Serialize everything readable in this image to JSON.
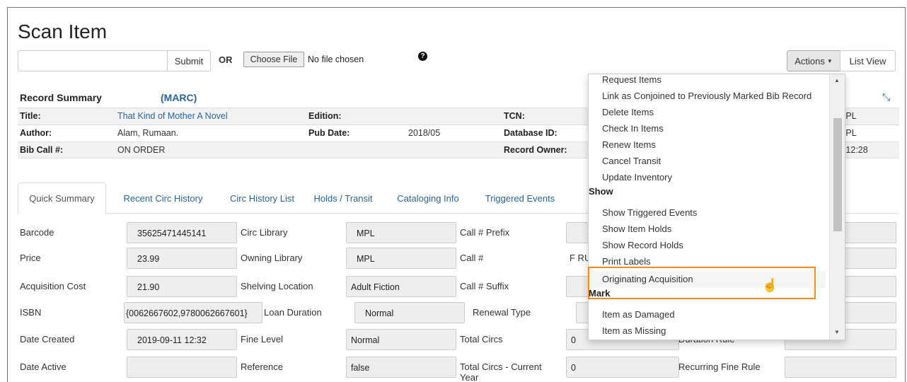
{
  "page": {
    "title": "Scan Item"
  },
  "scan": {
    "submit": "Submit",
    "or": "OR",
    "choose_file": "Choose File",
    "no_file": "No file chosen",
    "help_icon": "question-circle-icon"
  },
  "top_buttons": {
    "actions": "Actions",
    "list_view": "List View"
  },
  "record_summary": {
    "heading": "Record Summary",
    "marc": "(MARC)",
    "rows": [
      {
        "l1": "Title:",
        "v1": "That Kind of Mother A Novel",
        "l2": "Edition:",
        "v2": "",
        "l3": "TCN:",
        "v3": "MPL"
      },
      {
        "l1": "Author:",
        "v1": "Alam, Rumaan.",
        "l2": "Pub Date:",
        "v2": "2018/05",
        "l3": "Database ID:",
        "v3": "MPL"
      },
      {
        "l1": "Bib Call #:",
        "v1": "ON ORDER",
        "l2": "",
        "v2": "",
        "l3": "Record Owner:",
        "v3": "1 12:28"
      }
    ]
  },
  "tabs": [
    "Quick Summary",
    "Recent Circ History",
    "Circ History List",
    "Holds / Transit",
    "Cataloging Info",
    "Triggered Events"
  ],
  "fields": {
    "barcode": {
      "label": "Barcode",
      "value": "35625471445141"
    },
    "price": {
      "label": "Price",
      "value": "23.99"
    },
    "acq_cost": {
      "label": "Acquisition Cost",
      "value": "21.90"
    },
    "isbn": {
      "label": "ISBN",
      "value": "{0062667602,9780062667601}"
    },
    "date_created": {
      "label": "Date Created",
      "value": "2019-09-11 12:32"
    },
    "date_active": {
      "label": "Date Active",
      "value": ""
    },
    "circ_library": {
      "label": "Circ Library",
      "value": "MPL"
    },
    "owning_library": {
      "label": "Owning Library",
      "value": "MPL"
    },
    "shelving_location": {
      "label": "Shelving Location",
      "value": "Adult Fiction"
    },
    "loan_duration": {
      "label": "Loan Duration",
      "value": "Normal"
    },
    "fine_level": {
      "label": "Fine Level",
      "value": "Normal"
    },
    "reference": {
      "label": "Reference",
      "value": "false"
    },
    "call_prefix": {
      "label": "Call # Prefix",
      "value": ""
    },
    "call_num": {
      "label": "Call #",
      "value": "F RU"
    },
    "call_suffix": {
      "label": "Call # Suffix",
      "value": ""
    },
    "renewal_type": {
      "label": "Renewal Type",
      "value": ""
    },
    "total_circs": {
      "label": "Total Circs",
      "value": "0"
    },
    "total_circs_current": {
      "label": "Total Circs - Current Year",
      "value": "0"
    },
    "duration_rule": {
      "label": "Duration Rule",
      "value": ""
    },
    "recurring_fine_rule": {
      "label": "Recurring Fine Rule",
      "value": ""
    }
  },
  "menu": {
    "items_a": [
      "Request Items",
      "Link as Conjoined to Previously Marked Bib Record",
      "Delete Items",
      "Check In Items",
      "Renew Items",
      "Cancel Transit",
      "Update Inventory"
    ],
    "show_header": "Show",
    "items_b": [
      "Show Triggered Events",
      "Show Item Holds",
      "Show Record Holds",
      "Print Labels",
      "Originating Acquisition"
    ],
    "mark_header": "Mark",
    "items_c": [
      "Item as Damaged",
      "Item as Missing"
    ]
  },
  "colors": {
    "link": "#2a6496",
    "highlight_box": "#f08c1c"
  }
}
